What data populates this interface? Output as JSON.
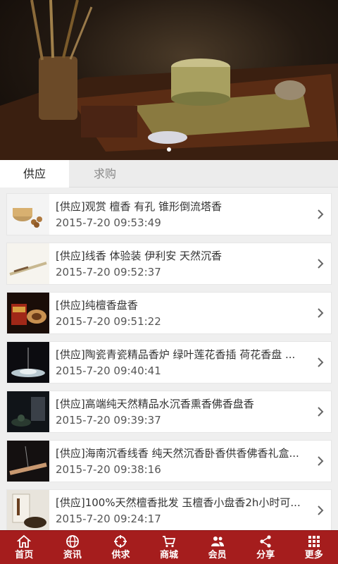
{
  "tabs": [
    {
      "label": "供应"
    },
    {
      "label": "求购"
    }
  ],
  "items": [
    {
      "title": "[供应]观赏 檀香 有孔 锥形倒流塔香",
      "date": "2015-7-20 09:53:49"
    },
    {
      "title": "[供应]线香 体验装 伊利安 天然沉香",
      "date": "2015-7-20 09:52:37"
    },
    {
      "title": "[供应]纯檀香盘香",
      "date": "2015-7-20 09:51:22"
    },
    {
      "title": "[供应]陶瓷青瓷精品香炉 绿叶莲花香插 荷花香盘 ...",
      "date": "2015-7-20 09:40:41"
    },
    {
      "title": "[供应]高端纯天然精品水沉香熏香佛香盘香",
      "date": "2015-7-20 09:39:37"
    },
    {
      "title": "[供应]海南沉香线香 纯天然沉香卧香供香佛香礼盒...",
      "date": "2015-7-20 09:38:16"
    },
    {
      "title": "[供应]100%天然檀香批发 玉檀香小盘香2h小时可...",
      "date": "2015-7-20 09:24:17"
    }
  ],
  "nav": [
    {
      "label": "首页",
      "icon": "home-icon"
    },
    {
      "label": "资讯",
      "icon": "globe-icon"
    },
    {
      "label": "供求",
      "icon": "target-icon"
    },
    {
      "label": "商城",
      "icon": "cart-icon"
    },
    {
      "label": "会员",
      "icon": "users-icon"
    },
    {
      "label": "分享",
      "icon": "share-icon"
    },
    {
      "label": "更多",
      "icon": "grid-icon"
    }
  ],
  "colors": {
    "nav_bg": "#a51d1d",
    "accent": "#a51d1d"
  }
}
